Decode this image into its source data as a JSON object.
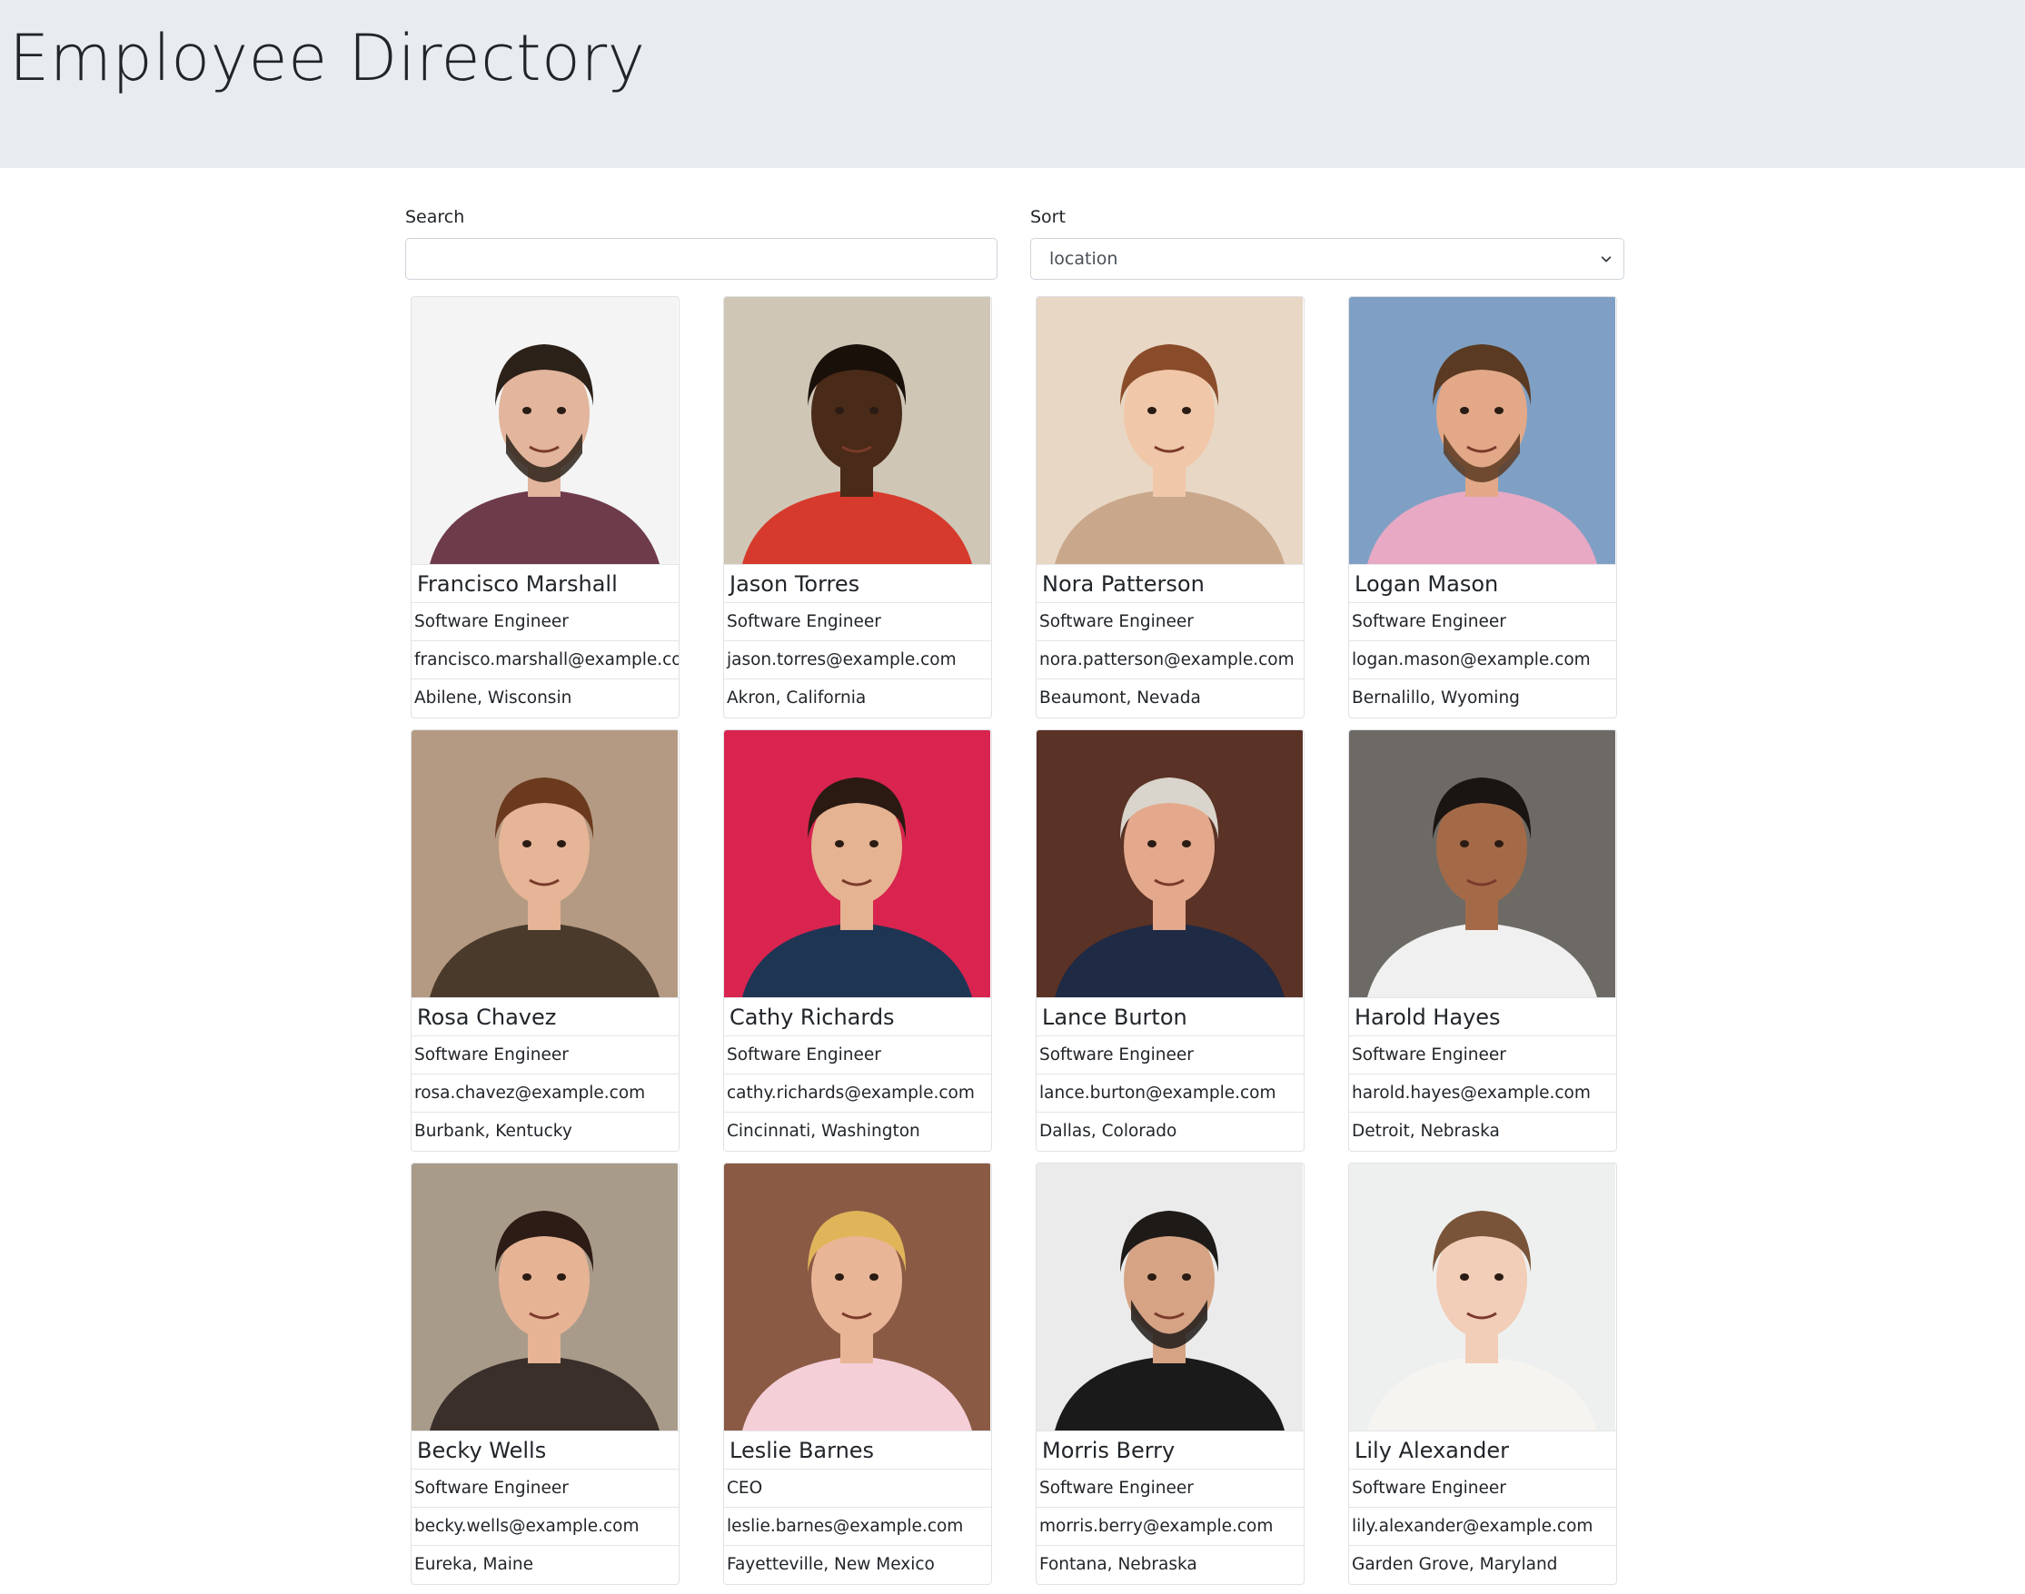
{
  "header": {
    "title": "Employee Directory"
  },
  "search": {
    "label": "Search",
    "value": "",
    "placeholder": ""
  },
  "sort": {
    "label": "Sort",
    "selected": "location"
  },
  "employees": [
    {
      "name": "Francisco Marshall",
      "title": "Software Engineer",
      "email": "francisco.marshall@example.com",
      "location": "Abilene, Wisconsin",
      "photo": {
        "bg": "#f4f4f4",
        "skin": "#e2b59c",
        "hair": "#2b2119",
        "shirt": "#6e3b4a",
        "beard": true
      }
    },
    {
      "name": "Jason Torres",
      "title": "Software Engineer",
      "email": "jason.torres@example.com",
      "location": "Akron, California",
      "photo": {
        "bg": "#cfc6b6",
        "skin": "#4a2a18",
        "hair": "#1a100a",
        "shirt": "#d63a2c",
        "beard": false
      }
    },
    {
      "name": "Nora Patterson",
      "title": "Software Engineer",
      "email": "nora.patterson@example.com",
      "location": "Beaumont, Nevada",
      "photo": {
        "bg": "#e8d7c4",
        "skin": "#f0c7a8",
        "hair": "#8a4b2a",
        "shirt": "#c9a78b",
        "beard": false
      }
    },
    {
      "name": "Logan Mason",
      "title": "Software Engineer",
      "email": "logan.mason@example.com",
      "location": "Bernalillo, Wyoming",
      "photo": {
        "bg": "#7fa0c4",
        "skin": "#e2a888",
        "hair": "#5a3a22",
        "shirt": "#e7a9c4",
        "beard": true
      }
    },
    {
      "name": "Rosa Chavez",
      "title": "Software Engineer",
      "email": "rosa.chavez@example.com",
      "location": "Burbank, Kentucky",
      "photo": {
        "bg": "#b49a82",
        "skin": "#e6b597",
        "hair": "#6b3a1e",
        "shirt": "#4a3a2c",
        "beard": false
      }
    },
    {
      "name": "Cathy Richards",
      "title": "Software Engineer",
      "email": "cathy.richards@example.com",
      "location": "Cincinnati, Washington",
      "photo": {
        "bg": "#d8244f",
        "skin": "#e5b391",
        "hair": "#2a1a12",
        "shirt": "#1f3554",
        "beard": false
      }
    },
    {
      "name": "Lance Burton",
      "title": "Software Engineer",
      "email": "lance.burton@example.com",
      "location": "Dallas, Colorado",
      "photo": {
        "bg": "#5a3226",
        "skin": "#e4a98c",
        "hair": "#d9d4cc",
        "shirt": "#1f2a44",
        "beard": false
      }
    },
    {
      "name": "Harold Hayes",
      "title": "Software Engineer",
      "email": "harold.hayes@example.com",
      "location": "Detroit, Nebraska",
      "photo": {
        "bg": "#6d6a66",
        "skin": "#a46a48",
        "hair": "#1a1412",
        "shirt": "#f0f0f0",
        "beard": false
      }
    },
    {
      "name": "Becky Wells",
      "title": "Software Engineer",
      "email": "becky.wells@example.com",
      "location": "Eureka, Maine",
      "photo": {
        "bg": "#a99b8a",
        "skin": "#e7b395",
        "hair": "#2c1c15",
        "shirt": "#3a2f2a",
        "beard": false
      }
    },
    {
      "name": "Leslie Barnes",
      "title": "CEO",
      "email": "leslie.barnes@example.com",
      "location": "Fayetteville, New Mexico",
      "photo": {
        "bg": "#8a5a44",
        "skin": "#e8b597",
        "hair": "#e0b55a",
        "shirt": "#f4cfd8",
        "beard": false
      }
    },
    {
      "name": "Morris Berry",
      "title": "Software Engineer",
      "email": "morris.berry@example.com",
      "location": "Fontana, Nebraska",
      "photo": {
        "bg": "#ebebeb",
        "skin": "#d6a485",
        "hair": "#1e1a17",
        "shirt": "#1a1a1a",
        "beard": true
      }
    },
    {
      "name": "Lily Alexander",
      "title": "Software Engineer",
      "email": "lily.alexander@example.com",
      "location": "Garden Grove, Maryland",
      "photo": {
        "bg": "#eef0ef",
        "skin": "#f2cdb7",
        "hair": "#7a5439",
        "shirt": "#f6f4f0",
        "beard": false
      }
    }
  ]
}
